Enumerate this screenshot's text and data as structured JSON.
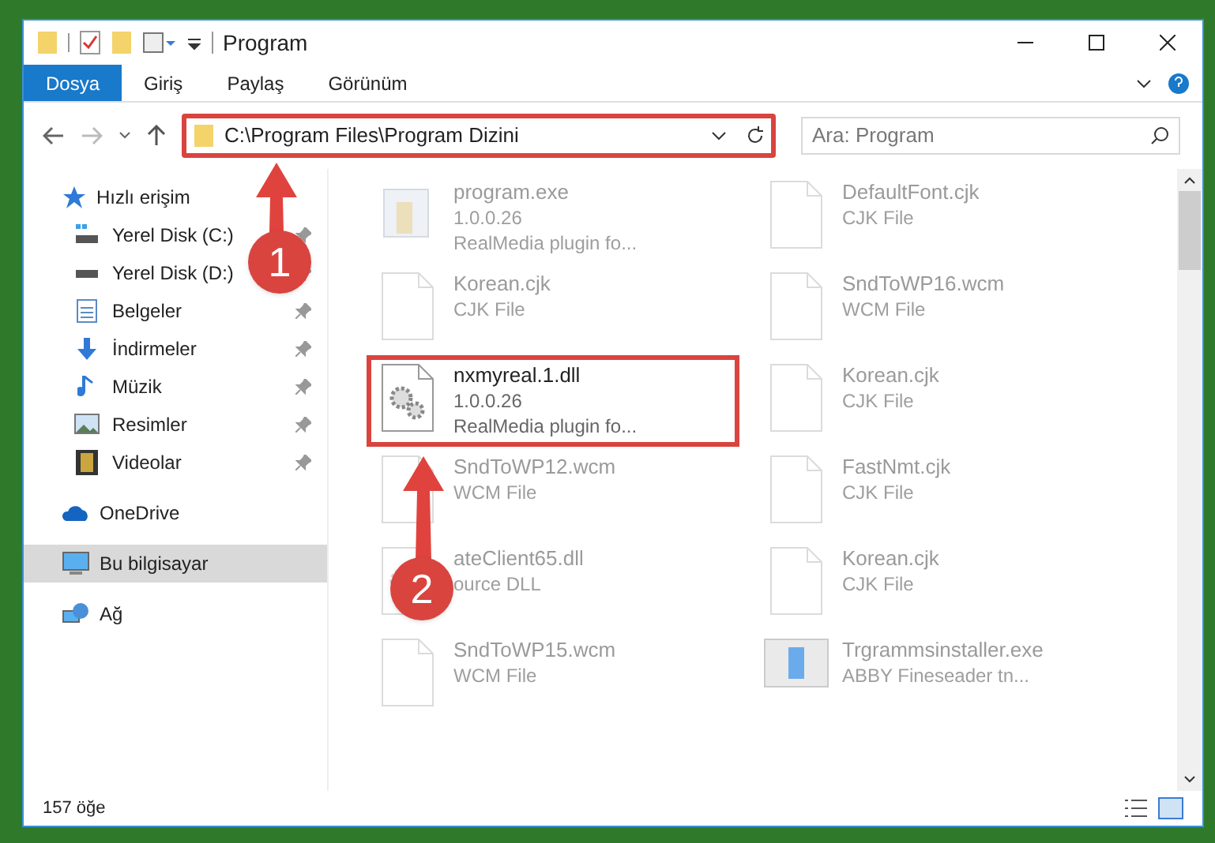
{
  "window": {
    "title": "Program"
  },
  "ribbon": {
    "tabs": [
      {
        "label": "Dosya",
        "selected": true
      },
      {
        "label": "Giriş",
        "selected": false
      },
      {
        "label": "Paylaş",
        "selected": false
      },
      {
        "label": "Görünüm",
        "selected": false
      }
    ]
  },
  "address": {
    "path": "C:\\Program Files\\Program Dizini",
    "highlighted": true
  },
  "search": {
    "placeholder": "Ara: Program"
  },
  "sidebar": {
    "items": [
      {
        "label": "Hızlı erişim",
        "selected": false,
        "children": [
          {
            "label": "Yerel Disk (C:)",
            "pinned": true
          },
          {
            "label": "Yerel Disk (D:)",
            "pinned": true
          },
          {
            "label": "Belgeler",
            "pinned": true
          },
          {
            "label": "İndirmeler",
            "pinned": true
          },
          {
            "label": "Müzik",
            "pinned": true
          },
          {
            "label": "Resimler",
            "pinned": true
          },
          {
            "label": "Videolar",
            "pinned": true
          }
        ]
      },
      {
        "label": "OneDrive",
        "selected": false
      },
      {
        "label": "Bu bilgisayar",
        "selected": true
      },
      {
        "label": "Ağ",
        "selected": false
      }
    ]
  },
  "files": [
    {
      "kind": "exe",
      "name": "program.exe",
      "lines": [
        "1.0.0.26",
        "RealMedia plugin fo..."
      ],
      "faded": true,
      "highlighted": false
    },
    {
      "kind": "document",
      "name": "DefaultFont.cjk",
      "lines": [
        "CJK File"
      ],
      "faded": true,
      "highlighted": false
    },
    {
      "kind": "document",
      "name": "Korean.cjk",
      "lines": [
        "CJK File"
      ],
      "faded": true,
      "highlighted": false
    },
    {
      "kind": "document",
      "name": "SndToWP16.wcm",
      "lines": [
        "WCM File"
      ],
      "faded": true,
      "highlighted": false
    },
    {
      "kind": "dll",
      "name": "nxmyreal.1.dll",
      "lines": [
        "1.0.0.26",
        "RealMedia plugin fo..."
      ],
      "faded": false,
      "highlighted": true
    },
    {
      "kind": "document",
      "name": "Korean.cjk",
      "lines": [
        "CJK File"
      ],
      "faded": true,
      "highlighted": false
    },
    {
      "kind": "document",
      "name": "SndToWP12.wcm",
      "lines": [
        "WCM File"
      ],
      "faded": true,
      "highlighted": false
    },
    {
      "kind": "document",
      "name": "FastNmt.cjk",
      "lines": [
        "CJK File"
      ],
      "faded": true,
      "highlighted": false
    },
    {
      "kind": "dll",
      "name": "ateClient65.dll",
      "lines": [
        "ource DLL"
      ],
      "faded": true,
      "highlighted": false
    },
    {
      "kind": "document",
      "name": "Korean.cjk",
      "lines": [
        "CJK File"
      ],
      "faded": true,
      "highlighted": false
    },
    {
      "kind": "document",
      "name": "SndToWP15.wcm",
      "lines": [
        "WCM File"
      ],
      "faded": true,
      "highlighted": false
    },
    {
      "kind": "installer",
      "name": "Trgrammsinstaller.exe",
      "lines": [
        "ABBY Fineseader tn..."
      ],
      "faded": true,
      "highlighted": false
    }
  ],
  "status_bar": {
    "count": "157 öğe"
  },
  "callouts": [
    "1",
    "2"
  ]
}
